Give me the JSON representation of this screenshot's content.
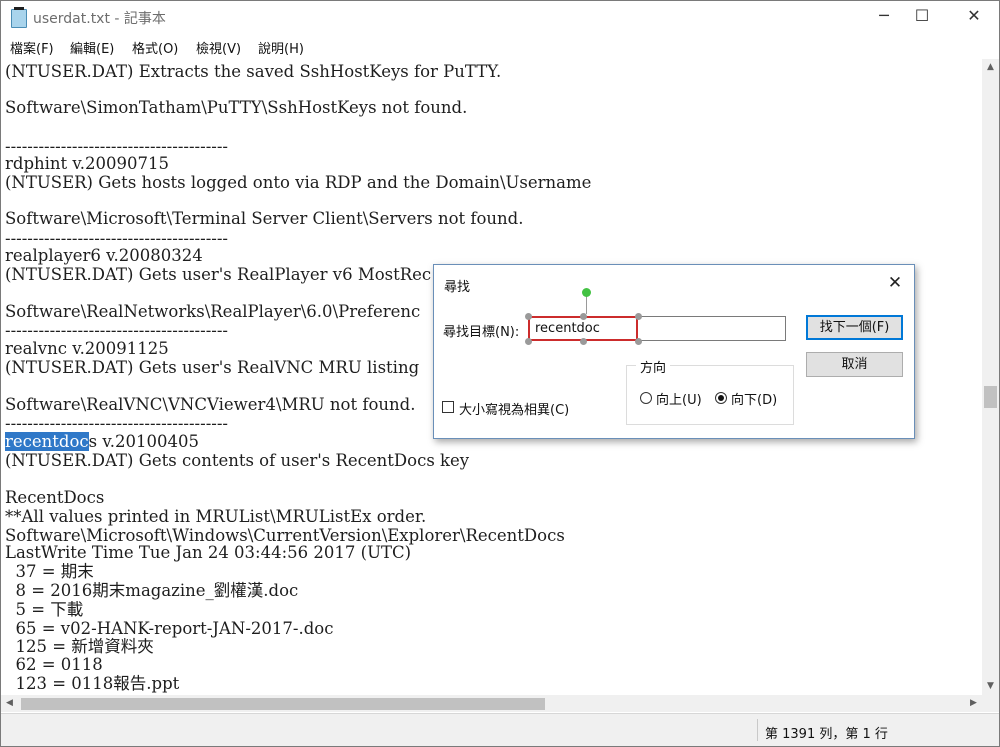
{
  "window": {
    "title": "userdat.txt - 記事本",
    "minimize": "─",
    "maximize": "☐",
    "close": "✕"
  },
  "menu": [
    "檔案(F)",
    "編輯(E)",
    "格式(O)",
    "檢視(V)",
    "說明(H)"
  ],
  "editor": {
    "lines": [
      "(NTUSER.DAT) Extracts the saved SshHostKeys for PuTTY.",
      "",
      "Software\\SimonTatham\\PuTTY\\SshHostKeys not found.",
      "",
      "----------------------------------------",
      "rdphint v.20090715",
      "(NTUSER) Gets hosts logged onto via RDP and the Domain\\Username",
      "",
      "Software\\Microsoft\\Terminal Server Client\\Servers not found.",
      "----------------------------------------",
      "realplayer6 v.20080324",
      "(NTUSER.DAT) Gets user's RealPlayer v6 MostRec",
      "",
      "Software\\RealNetworks\\RealPlayer\\6.0\\Preferenc",
      "----------------------------------------",
      "realvnc v.20091125",
      "(NTUSER.DAT) Gets user's RealVNC MRU listing",
      "",
      "Software\\RealVNC\\VNCViewer4\\MRU not found.",
      "----------------------------------------",
      "s v.20100405",
      "(NTUSER.DAT) Gets contents of user's RecentDocs key",
      "",
      "RecentDocs",
      "**All values printed in MRUList\\MRUListEx order.",
      "Software\\Microsoft\\Windows\\CurrentVersion\\Explorer\\RecentDocs",
      "LastWrite Time Tue Jan 24 03:44:56 2017 (UTC)",
      "  37 = 期末",
      "  8 = 2016期末magazine_劉權漢.doc",
      "  5 = 下載",
      "  65 = v02-HANK-report-JAN-2017-.doc",
      "  125 = 新增資料夾",
      "  62 = 0118",
      "  123 = 0118報告.ppt"
    ],
    "selected_text": "recentdoc"
  },
  "status": {
    "position": "第 1391 列，第 1 行"
  },
  "find_dialog": {
    "title": "尋找",
    "find_label": "尋找目標(N):",
    "find_value": "recentdoc",
    "find_next": "找下一個(F)",
    "cancel": "取消",
    "direction_label": "方向",
    "up_label": "向上(U)",
    "down_label": "向下(D)",
    "direction_selected": "down",
    "match_case_label": "大小寫視為相異(C)",
    "match_case": false,
    "close": "✕"
  },
  "icons": {
    "app": "notepad-icon",
    "scroll_up": "▲",
    "scroll_down": "▼",
    "scroll_left": "◀",
    "scroll_right": "▶"
  }
}
